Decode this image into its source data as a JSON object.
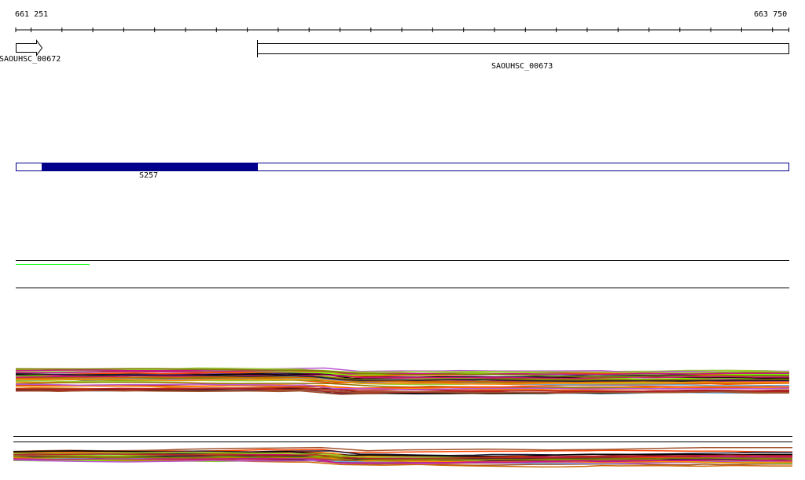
{
  "ruler": {
    "start_label": "661 251",
    "end_label": "663 750"
  },
  "genes": [
    {
      "name": "SAOUHSC_00672",
      "strand": "+"
    },
    {
      "name": "SAOUHSC_00673",
      "strand": "-"
    }
  ],
  "feature_track": {
    "label": "S257",
    "color": "#00008b"
  },
  "coverage_track": {
    "color": "#00ff00"
  },
  "colors": {
    "palette": [
      "#000000",
      "#8b7500",
      "#cd6600",
      "#ff4500",
      "#cd1076",
      "#6ca6cd",
      "#7cfc00",
      "#9acd32",
      "#1c1c3c",
      "#b22222",
      "#ba55d3",
      "#a0522d",
      "#ff8c00",
      "#c71585",
      "#808000"
    ]
  }
}
